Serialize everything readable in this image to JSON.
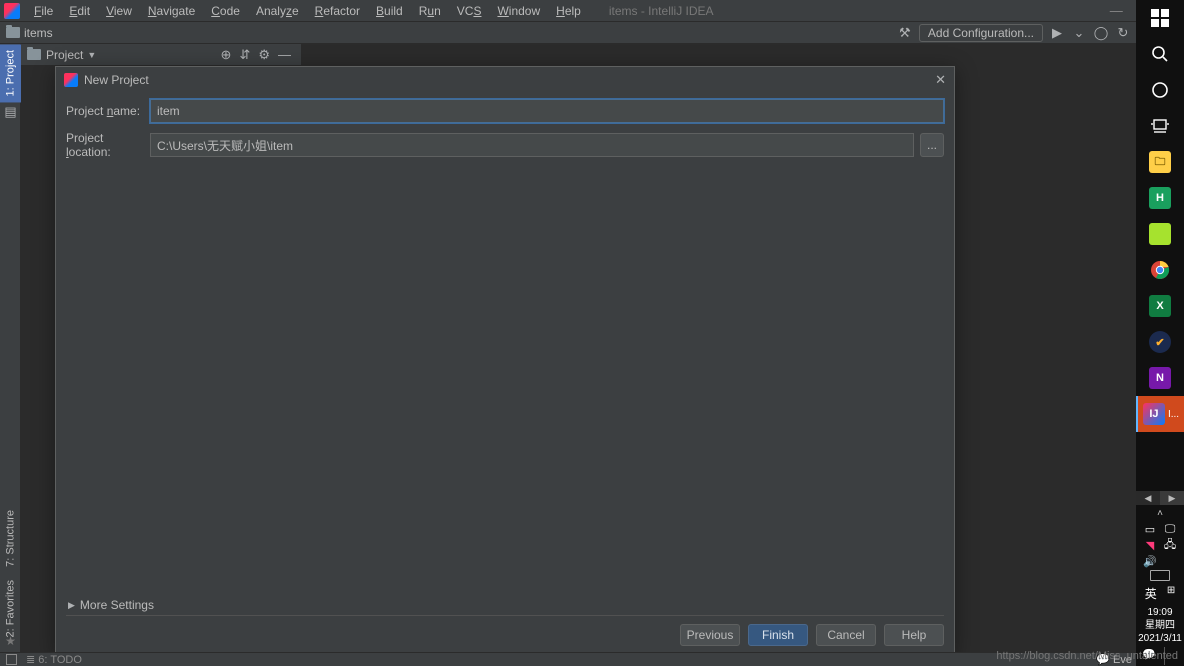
{
  "menu": {
    "file": "File",
    "edit": "Edit",
    "view": "View",
    "navigate": "Navigate",
    "code": "Code",
    "analyze": "Analyze",
    "refactor": "Refactor",
    "build": "Build",
    "run": "Run",
    "vcs": "VCS",
    "window": "Window",
    "help": "Help"
  },
  "title_bar_title": "items - IntelliJ IDEA",
  "breadcrumb": "items",
  "toolbar": {
    "add_configuration": "Add Configuration..."
  },
  "project_panel": {
    "label": "Project"
  },
  "left_tabs": {
    "project": "1: Project",
    "structure": "7: Structure",
    "favorites": "2: Favorites"
  },
  "dialog": {
    "title": "New Project",
    "name_label": "Project name:",
    "name_value": "item",
    "location_label": "Project location:",
    "location_value": "C:\\Users\\无天赋小姐\\item",
    "more_settings": "More Settings",
    "previous": "Previous",
    "finish": "Finish",
    "cancel": "Cancel",
    "help": "Help"
  },
  "statusbar": {
    "todo": "6: TODO",
    "event": "Eve"
  },
  "tray": {
    "lang": "英",
    "time": "19:09",
    "day": "星期四",
    "date": "2021/3/11"
  },
  "watermark": "https://blog.csdn.net/Miss_untalented",
  "taskbar_apps": {
    "intellij": "I..."
  },
  "colors": {
    "accent": "#365880"
  }
}
